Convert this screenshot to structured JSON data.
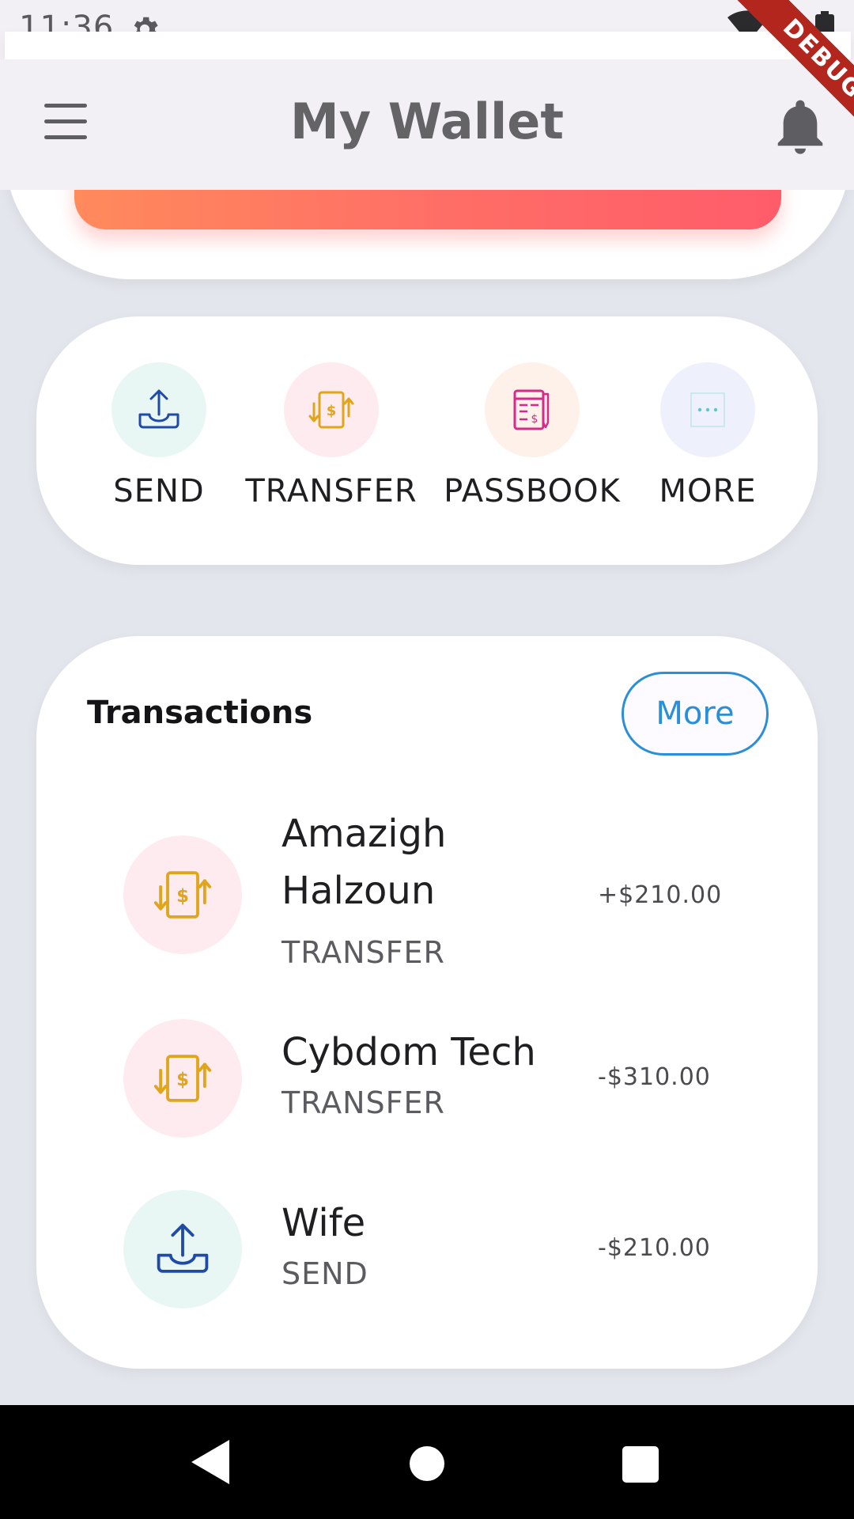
{
  "status_bar": {
    "time": "11:36"
  },
  "app_bar": {
    "title": "My Wallet",
    "debug_label": "DEBUG"
  },
  "actions": [
    {
      "label": "SEND",
      "icon": "send-upload-icon",
      "bg": "#e9f7f4"
    },
    {
      "label": "TRANSFER",
      "icon": "transfer-dollar-icon",
      "bg": "#fdebf0"
    },
    {
      "label": "PASSBOOK",
      "icon": "passbook-icon",
      "bg": "#fdf1ea"
    },
    {
      "label": "MORE",
      "icon": "more-dots-icon",
      "bg": "#eef0fc"
    }
  ],
  "transactions": {
    "title": "Transactions",
    "more_label": "More",
    "items": [
      {
        "name": "Amazigh Halzoun",
        "type": "TRANSFER",
        "amount": "+$210.00",
        "icon": "transfer-dollar-icon"
      },
      {
        "name": "Cybdom Tech",
        "type": "TRANSFER",
        "amount": "-$310.00",
        "icon": "transfer-dollar-icon"
      },
      {
        "name": "Wife",
        "type": "SEND",
        "amount": "-$210.00",
        "icon": "send-upload-icon"
      }
    ]
  },
  "colors": {
    "accent_blue": "#2a8fd8",
    "gradient_start": "#ff8a5c",
    "gradient_end": "#ff5c6a",
    "icon_gold": "#e0a51a",
    "icon_navy": "#1f4aa8",
    "icon_pink": "#d8298a"
  }
}
